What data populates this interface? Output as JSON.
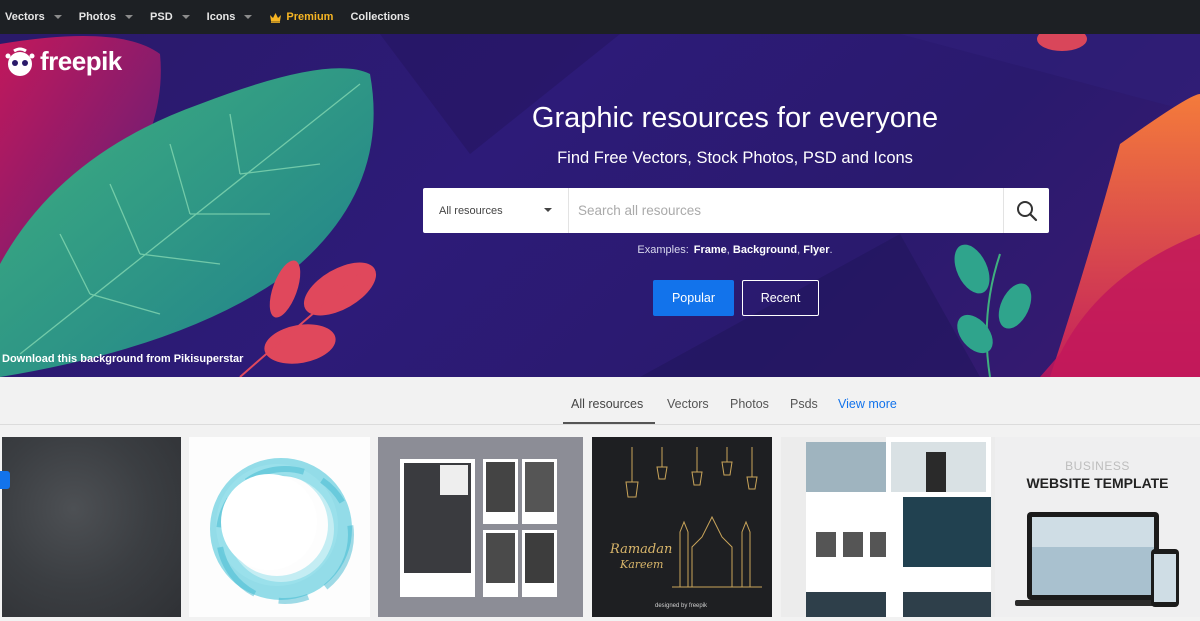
{
  "nav": {
    "items": [
      {
        "label": "Vectors",
        "dropdown": true
      },
      {
        "label": "Photos",
        "dropdown": true
      },
      {
        "label": "PSD",
        "dropdown": true
      },
      {
        "label": "Icons",
        "dropdown": true
      }
    ],
    "premium_label": "Premium",
    "collections_label": "Collections"
  },
  "logo": {
    "text": "freepik"
  },
  "hero": {
    "title": "Graphic resources for everyone",
    "subtitle": "Find Free Vectors, Stock Photos, PSD and Icons",
    "search": {
      "selected_resource": "All resources",
      "placeholder": "Search all resources"
    },
    "examples_label": "Examples:",
    "examples": [
      "Frame",
      "Background",
      "Flyer"
    ],
    "popular_label": "Popular",
    "recent_label": "Recent",
    "credit": "Download this background from Pikisuperstar"
  },
  "tabs": {
    "items": [
      "All resources",
      "Vectors",
      "Photos",
      "Psds"
    ],
    "active": "All resources",
    "view_more": "View more"
  },
  "thumbnails": {
    "ramadan_line1": "Ramadan",
    "ramadan_line2": "Kareem",
    "designed_by": "designed by freepik",
    "business_top": "BUSINESS",
    "business_main": "WEBSITE TEMPLATE"
  },
  "colors": {
    "accent_blue": "#1273eb",
    "premium_gold": "#f6b523",
    "nav_bg": "#1d2024",
    "hero_bg": "#2a1a6a"
  },
  "icons": [
    "crown-icon",
    "freepik-logo-icon",
    "search-icon",
    "caret-down-icon"
  ]
}
